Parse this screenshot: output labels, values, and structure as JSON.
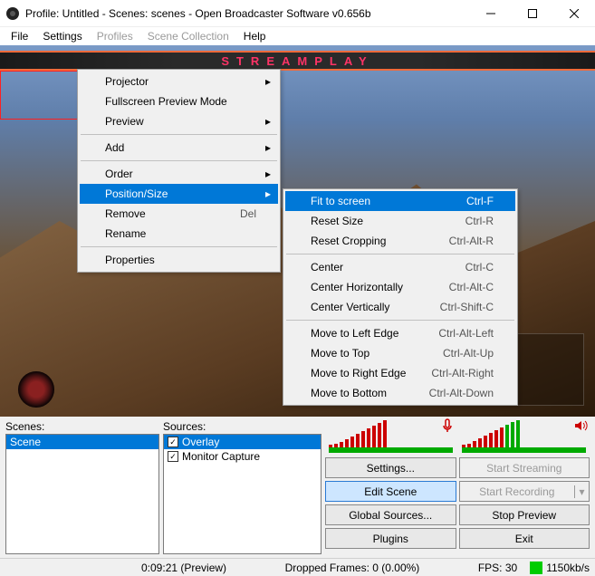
{
  "window": {
    "title": "Profile: Untitled - Scenes: scenes - Open Broadcaster Software v0.656b"
  },
  "menubar": {
    "file": "File",
    "settings": "Settings",
    "profiles": "Profiles",
    "scene_collection": "Scene Collection",
    "help": "Help"
  },
  "overlay_brand": "STREAMPLAY",
  "context_menu": {
    "projector": "Projector",
    "fullscreen_preview": "Fullscreen Preview Mode",
    "preview": "Preview",
    "add": "Add",
    "order": "Order",
    "position_size": "Position/Size",
    "remove": "Remove",
    "remove_sc": "Del",
    "rename": "Rename",
    "properties": "Properties"
  },
  "submenu": {
    "fit": "Fit to screen",
    "fit_sc": "Ctrl-F",
    "reset_size": "Reset Size",
    "reset_size_sc": "Ctrl-R",
    "reset_crop": "Reset Cropping",
    "reset_crop_sc": "Ctrl-Alt-R",
    "center": "Center",
    "center_sc": "Ctrl-C",
    "center_h": "Center Horizontally",
    "center_h_sc": "Ctrl-Alt-C",
    "center_v": "Center Vertically",
    "center_v_sc": "Ctrl-Shift-C",
    "move_left": "Move to Left Edge",
    "move_left_sc": "Ctrl-Alt-Left",
    "move_top": "Move to Top",
    "move_top_sc": "Ctrl-Alt-Up",
    "move_right": "Move to Right Edge",
    "move_right_sc": "Ctrl-Alt-Right",
    "move_bottom": "Move to Bottom",
    "move_bottom_sc": "Ctrl-Alt-Down"
  },
  "panels": {
    "scenes_label": "Scenes:",
    "sources_label": "Sources:",
    "scenes": {
      "0": "Scene"
    },
    "sources": {
      "0": "Overlay",
      "1": "Monitor Capture"
    }
  },
  "buttons": {
    "settings": "Settings...",
    "start_streaming": "Start Streaming",
    "edit_scene": "Edit Scene",
    "start_recording": "Start Recording",
    "global_sources": "Global Sources...",
    "stop_preview": "Stop Preview",
    "plugins": "Plugins",
    "exit": "Exit"
  },
  "status": {
    "time": "0:09:21 (Preview)",
    "dropped": "Dropped Frames: 0 (0.00%)",
    "fps": "FPS: 30",
    "bitrate": "1150kb/s"
  }
}
